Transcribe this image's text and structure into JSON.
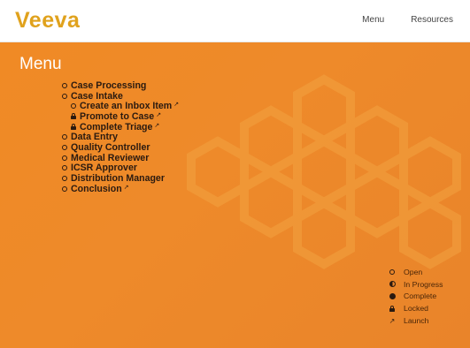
{
  "header": {
    "logo_text": "Veeva",
    "nav": [
      {
        "label": "Menu"
      },
      {
        "label": "Resources"
      }
    ]
  },
  "page": {
    "title": "Menu"
  },
  "menu_items": [
    {
      "label": "Case Processing",
      "status": "open",
      "level": 0,
      "external": false
    },
    {
      "label": "Case Intake",
      "status": "open",
      "level": 0,
      "external": false
    },
    {
      "label": "Create an Inbox Item",
      "status": "open",
      "level": 1,
      "external": true
    },
    {
      "label": "Promote to Case",
      "status": "locked",
      "level": 1,
      "external": true
    },
    {
      "label": "Complete Triage",
      "status": "locked",
      "level": 1,
      "external": true
    },
    {
      "label": "Data Entry",
      "status": "open",
      "level": 0,
      "external": false
    },
    {
      "label": "Quality Controller",
      "status": "open",
      "level": 0,
      "external": false
    },
    {
      "label": "Medical Reviewer",
      "status": "open",
      "level": 0,
      "external": false
    },
    {
      "label": "ICSR Approver",
      "status": "open",
      "level": 0,
      "external": false
    },
    {
      "label": "Distribution Manager",
      "status": "open",
      "level": 0,
      "external": false
    },
    {
      "label": "Conclusion",
      "status": "open",
      "level": 0,
      "external": true
    }
  ],
  "legend": [
    {
      "label": "Open",
      "icon": "open-circle-icon"
    },
    {
      "label": "In Progress",
      "icon": "half-circle-icon"
    },
    {
      "label": "Complete",
      "icon": "filled-circle-icon"
    },
    {
      "label": "Locked",
      "icon": "lock-icon"
    },
    {
      "label": "Launch",
      "icon": "external-link-icon"
    }
  ],
  "colors": {
    "background": "#ee8a2a",
    "header_bg": "#ffffff",
    "logo": "#e0a21d",
    "page_title": "#ffffff",
    "text_dark": "#2a1a10"
  }
}
